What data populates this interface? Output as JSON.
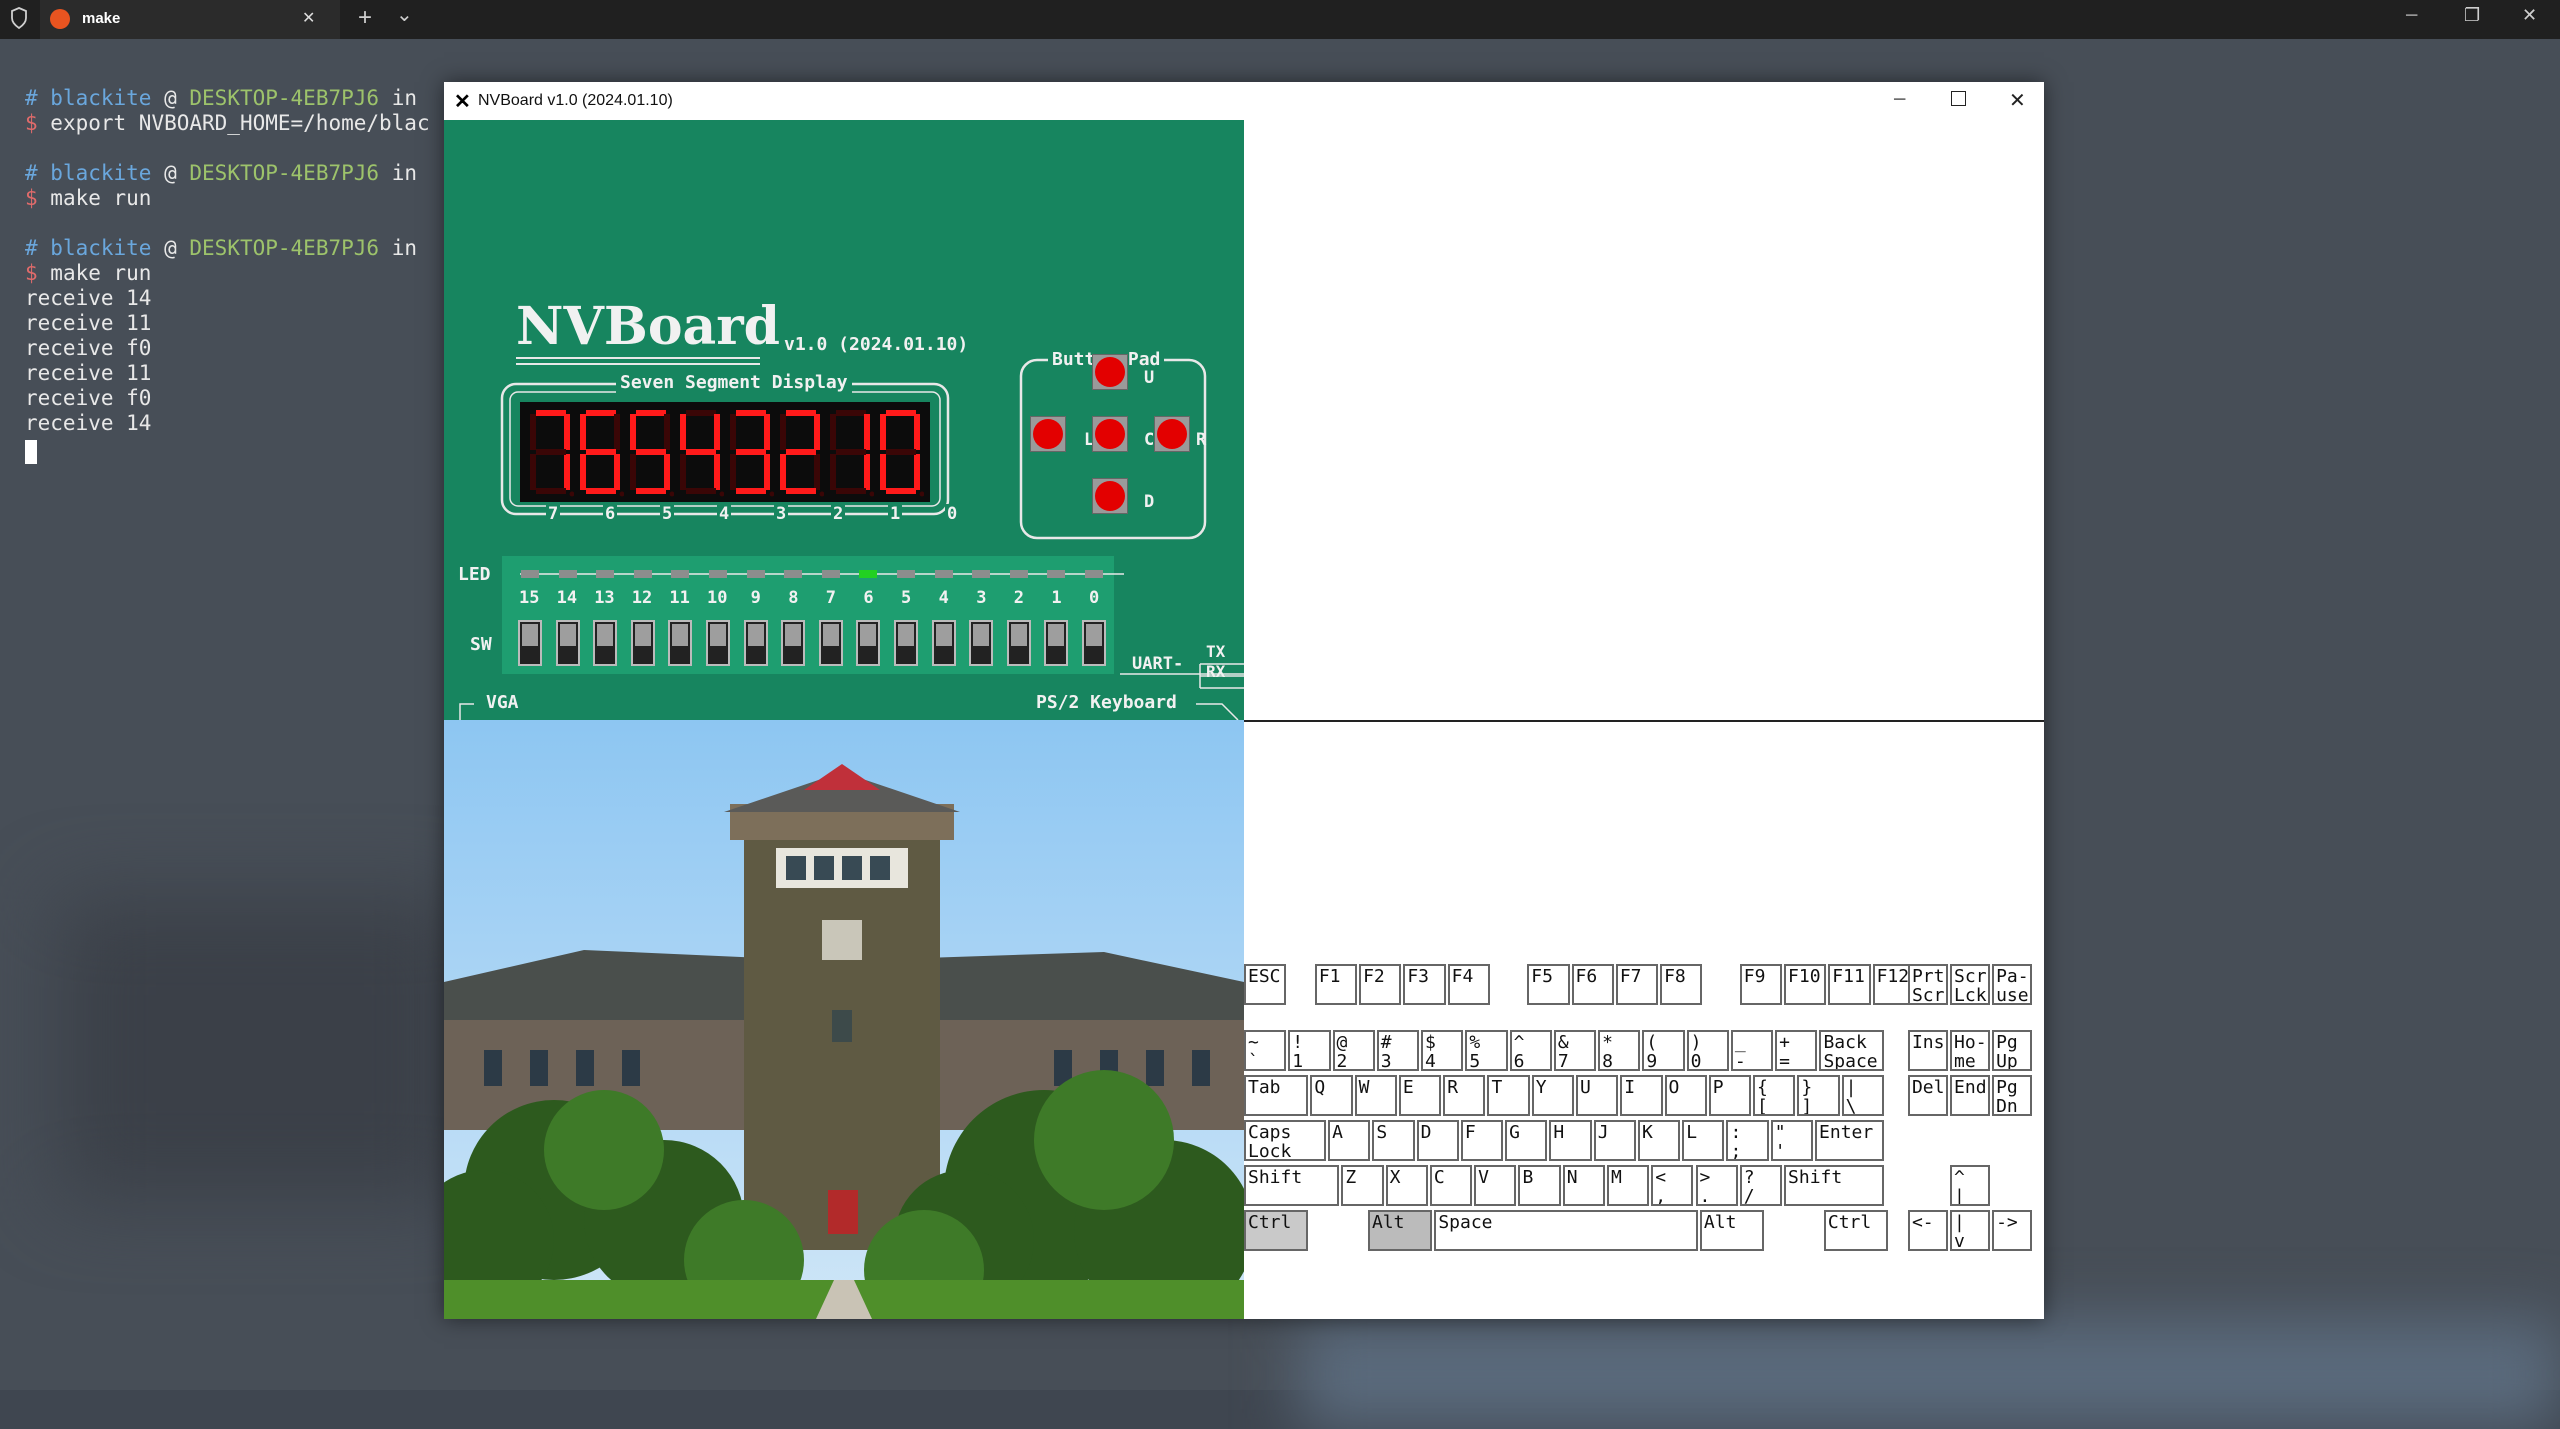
{
  "tab": {
    "title": "make",
    "new_tab": "+",
    "dropdown": "⌄",
    "close": "✕"
  },
  "window_controls": {
    "minimize": "─",
    "maximize": "❐",
    "close": "✕"
  },
  "terminal": {
    "lines": [
      {
        "hash": "# ",
        "user": "blackite",
        "at": " @ ",
        "host": "DESKTOP-4EB7PJ6",
        "rest": " in"
      },
      {
        "dollar": "$ ",
        "cmd": "export NVBOARD_HOME=/home/blac"
      },
      {
        "blank": ""
      },
      {
        "hash": "# ",
        "user": "blackite",
        "at": " @ ",
        "host": "DESKTOP-4EB7PJ6",
        "rest": " in"
      },
      {
        "dollar": "$ ",
        "cmd": "make run"
      },
      {
        "blank": ""
      },
      {
        "hash": "# ",
        "user": "blackite",
        "at": " @ ",
        "host": "DESKTOP-4EB7PJ6",
        "rest": " in"
      },
      {
        "dollar": "$ ",
        "cmd": "make run"
      },
      {
        "out": "receive 14"
      },
      {
        "out": "receive 11"
      },
      {
        "out": "receive f0"
      },
      {
        "out": "receive 11"
      },
      {
        "out": "receive f0"
      },
      {
        "out": "receive 14"
      }
    ]
  },
  "nvboard": {
    "window_title": "NVBoard v1.0 (2024.01.10)",
    "logo": "NVBoard",
    "version": "v1.0 (2024.01.10)",
    "seg_title": "Seven Segment Display",
    "seg_digits": [
      "7",
      "6",
      "5",
      "4",
      "3",
      "2",
      "1",
      "0"
    ],
    "seg_values": [
      "7",
      "6",
      "5",
      "4",
      "3",
      "2",
      "1",
      "0"
    ],
    "button_pad_title": "Button Pad",
    "buttons": {
      "up": "U",
      "left": "L",
      "center": "C",
      "right": "R",
      "down": "D"
    },
    "led_label": "LED",
    "sw_label": "SW",
    "led_numbers": [
      "15",
      "14",
      "13",
      "12",
      "11",
      "10",
      "9",
      "8",
      "7",
      "6",
      "5",
      "4",
      "3",
      "2",
      "1",
      "0"
    ],
    "led_on_index": 9,
    "uart_label": "UART-",
    "tx_label": "TX",
    "rx_label": "RX",
    "vga_label": "VGA",
    "ps2_label": "PS/2 Keyboard"
  },
  "colors": {
    "board": "#17855f",
    "led_on": "#22d022",
    "led_off": "#8d8d8d",
    "seg_on": "#ff1a1a",
    "button": "#e30000"
  },
  "keyboard": {
    "rows": [
      [
        [
          "ESC",
          ""
        ],
        [
          "F1",
          ""
        ],
        [
          "F2",
          ""
        ],
        [
          "F3",
          ""
        ],
        [
          "F4",
          ""
        ],
        [
          "F5",
          ""
        ],
        [
          "F6",
          ""
        ],
        [
          "F7",
          ""
        ],
        [
          "F8",
          ""
        ],
        [
          "F9",
          ""
        ],
        [
          "F10",
          ""
        ],
        [
          "F11",
          ""
        ],
        [
          "F12",
          ""
        ],
        [
          "Prt\nScr",
          ""
        ],
        [
          "Scr\nLck",
          ""
        ],
        [
          "Pa-\nuse",
          ""
        ]
      ],
      [
        [
          "~\n`",
          ""
        ],
        [
          "!\n1",
          ""
        ],
        [
          "@\n2",
          ""
        ],
        [
          "#\n3",
          ""
        ],
        [
          "$\n4",
          ""
        ],
        [
          "%\n5",
          ""
        ],
        [
          "^\n6",
          ""
        ],
        [
          "&\n7",
          ""
        ],
        [
          "*\n8",
          ""
        ],
        [
          "(\n9",
          ""
        ],
        [
          ")\n0",
          ""
        ],
        [
          "_\n-",
          ""
        ],
        [
          "+\n=",
          ""
        ],
        [
          "Back\nSpace",
          ""
        ],
        [
          "Ins",
          ""
        ],
        [
          "Ho-\nme",
          ""
        ],
        [
          "Pg\nUp",
          ""
        ]
      ],
      [
        [
          "Tab",
          ""
        ],
        [
          "Q",
          ""
        ],
        [
          "W",
          ""
        ],
        [
          "E",
          ""
        ],
        [
          "R",
          ""
        ],
        [
          "T",
          ""
        ],
        [
          "Y",
          ""
        ],
        [
          "U",
          ""
        ],
        [
          "I",
          ""
        ],
        [
          "O",
          ""
        ],
        [
          "P",
          ""
        ],
        [
          "{\n[",
          ""
        ],
        [
          "}\n]",
          ""
        ],
        [
          "|\n\\",
          ""
        ],
        [
          "Del",
          ""
        ],
        [
          "End",
          ""
        ],
        [
          "Pg\nDn",
          ""
        ]
      ],
      [
        [
          "Caps\nLock",
          ""
        ],
        [
          "A",
          ""
        ],
        [
          "S",
          ""
        ],
        [
          "D",
          ""
        ],
        [
          "F",
          ""
        ],
        [
          "G",
          ""
        ],
        [
          "H",
          ""
        ],
        [
          "J",
          ""
        ],
        [
          "K",
          ""
        ],
        [
          "L",
          ""
        ],
        [
          ":\n;",
          ""
        ],
        [
          "\"\n'",
          ""
        ],
        [
          "Enter",
          ""
        ]
      ],
      [
        [
          "Shift",
          ""
        ],
        [
          "Z",
          ""
        ],
        [
          "X",
          ""
        ],
        [
          "C",
          ""
        ],
        [
          "V",
          ""
        ],
        [
          "B",
          ""
        ],
        [
          "N",
          ""
        ],
        [
          "M",
          ""
        ],
        [
          "<\n,",
          ""
        ],
        [
          ">\n.",
          ""
        ],
        [
          "?\n/",
          ""
        ],
        [
          "Shift",
          ""
        ],
        [
          "^\n|",
          ""
        ]
      ],
      [
        [
          "Ctrl",
          "dim"
        ],
        [
          "Alt",
          "hold"
        ],
        [
          "Space",
          ""
        ],
        [
          "Alt",
          ""
        ],
        [
          "Ctrl",
          ""
        ],
        [
          "<-",
          ""
        ],
        [
          "|\nv",
          ""
        ],
        [
          "->",
          ""
        ]
      ]
    ]
  }
}
